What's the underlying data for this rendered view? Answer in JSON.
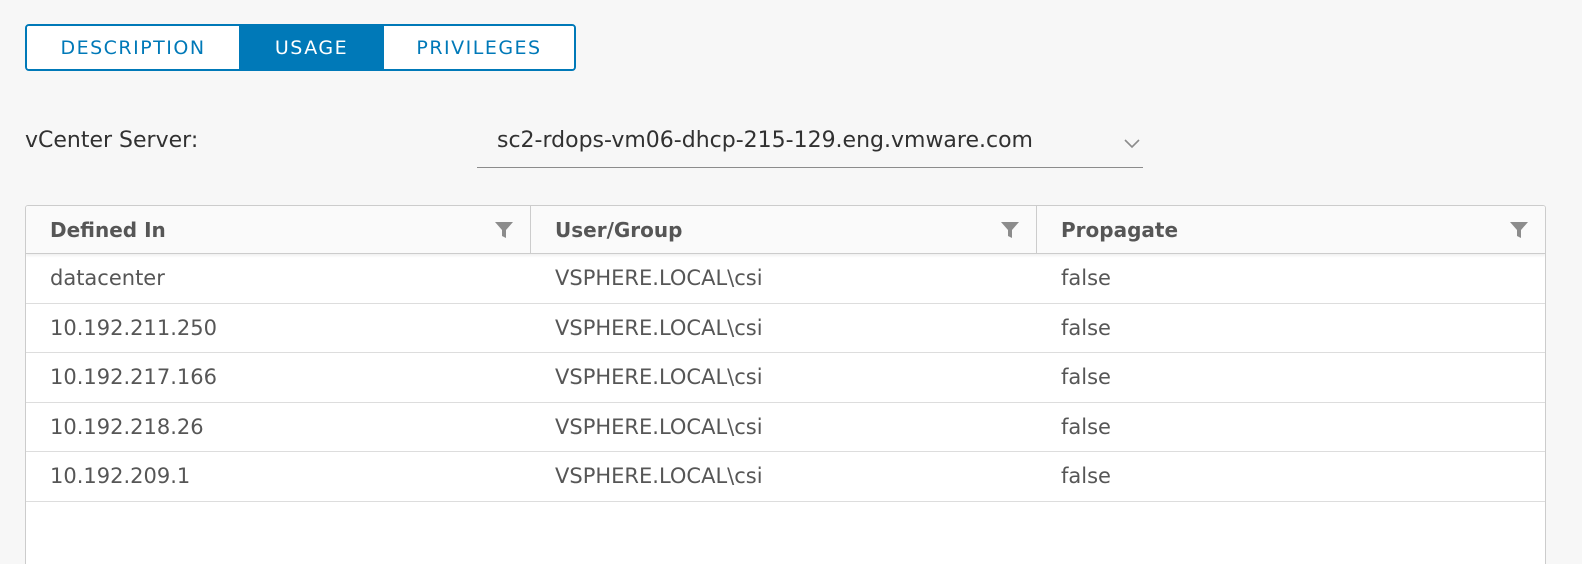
{
  "tabs": [
    {
      "label": "DESCRIPTION",
      "active": false
    },
    {
      "label": "USAGE",
      "active": true
    },
    {
      "label": "PRIVILEGES",
      "active": false
    }
  ],
  "server": {
    "label": "vCenter Server:",
    "value": "sc2-rdops-vm06-dhcp-215-129.eng.vmware.com",
    "icon": "chevron-down-icon"
  },
  "grid": {
    "columns": [
      "Defined In",
      "User/Group",
      "Propagate"
    ],
    "column_icon": "filter-icon",
    "rows": [
      [
        "datacenter",
        "VSPHERE.LOCAL\\csi",
        "false"
      ],
      [
        "10.192.211.250",
        "VSPHERE.LOCAL\\csi",
        "false"
      ],
      [
        "10.192.217.166",
        "VSPHERE.LOCAL\\csi",
        "false"
      ],
      [
        "10.192.218.26",
        "VSPHERE.LOCAL\\csi",
        "false"
      ],
      [
        "10.192.209.1",
        "VSPHERE.LOCAL\\csi",
        "false"
      ]
    ]
  },
  "colors": {
    "accent": "#0079b8",
    "background": "#f7f7f7",
    "border": "#cccccc",
    "text": "#565656"
  }
}
